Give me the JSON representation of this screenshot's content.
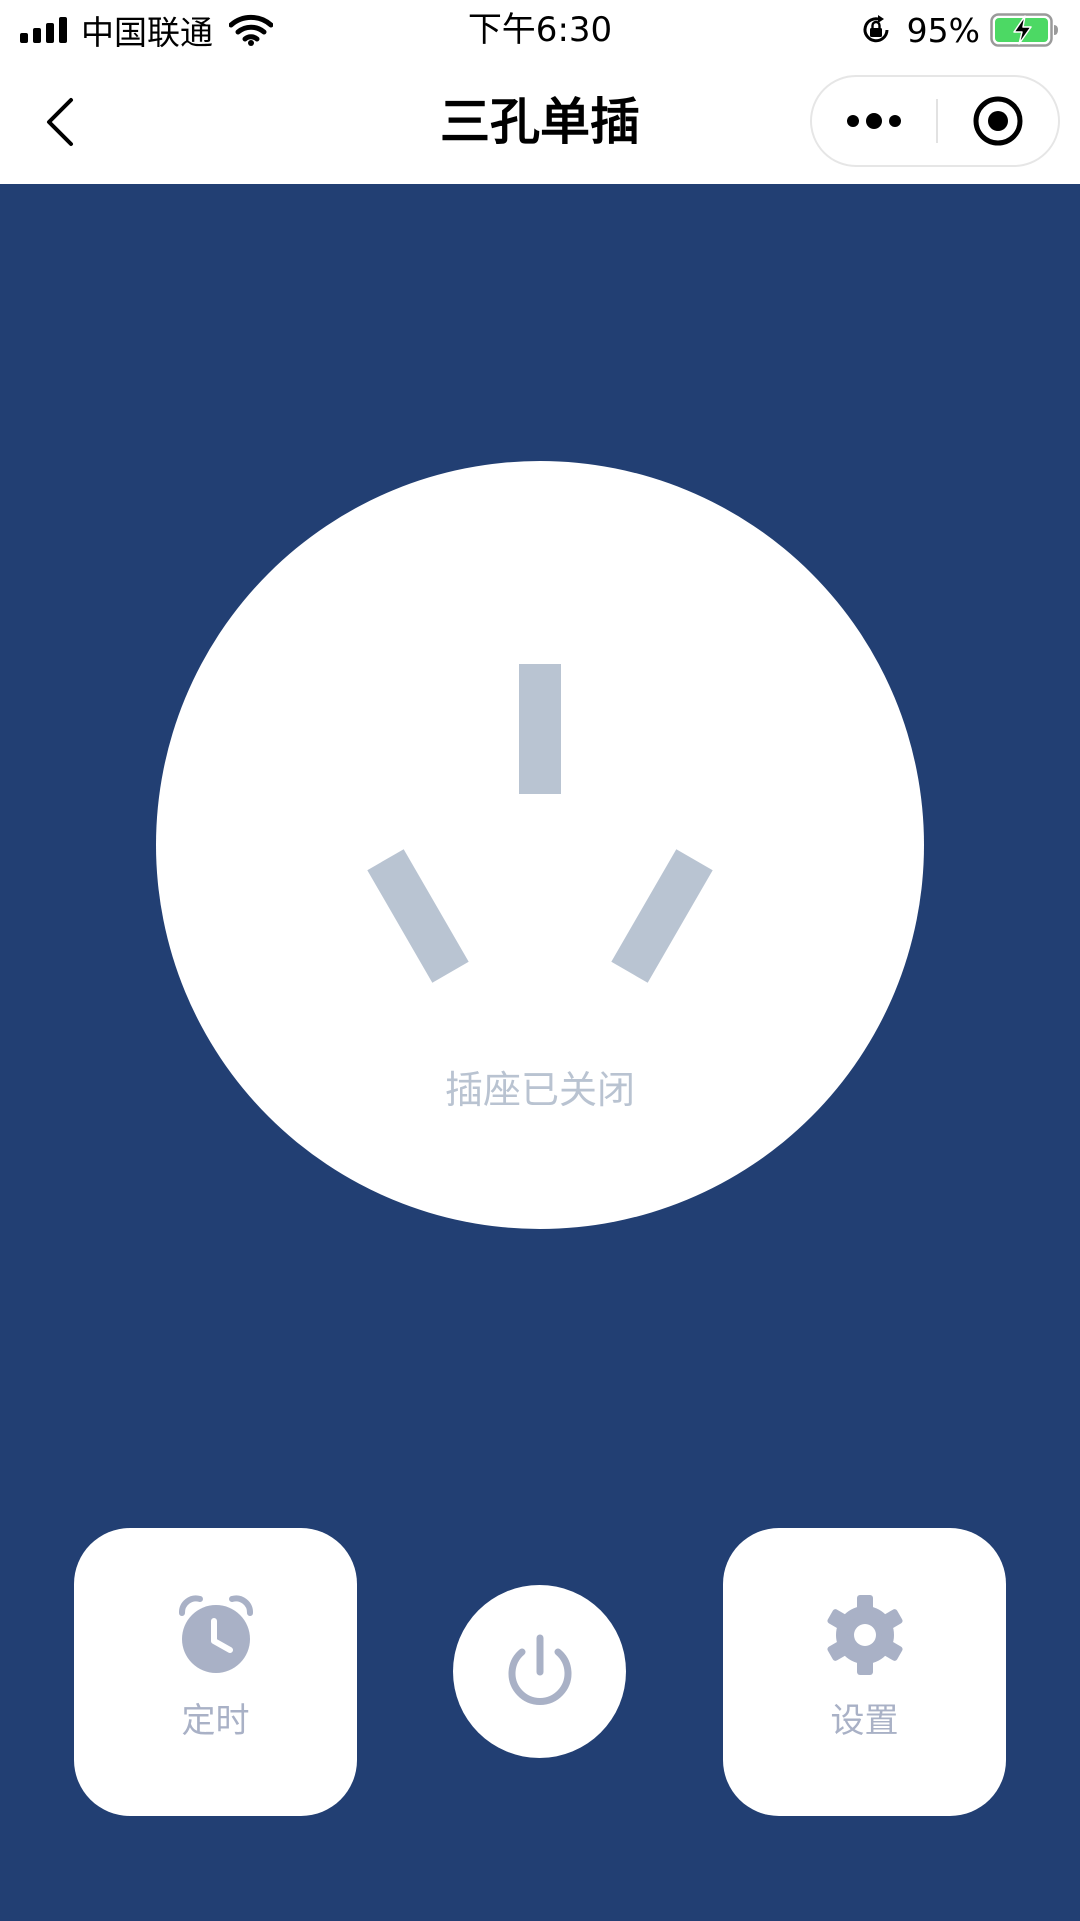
{
  "status_bar": {
    "carrier": "中国联通",
    "time": "下午6:30",
    "battery_percent": "95%"
  },
  "nav": {
    "title": "三孔单插"
  },
  "socket": {
    "status_text": "插座已关闭",
    "hole_color": "#b9c4d2"
  },
  "actions": {
    "timer_label": "定时",
    "settings_label": "设置"
  },
  "colors": {
    "background": "#223f73",
    "icon_gray": "#a9b1c6",
    "battery_green": "#4cd964"
  }
}
